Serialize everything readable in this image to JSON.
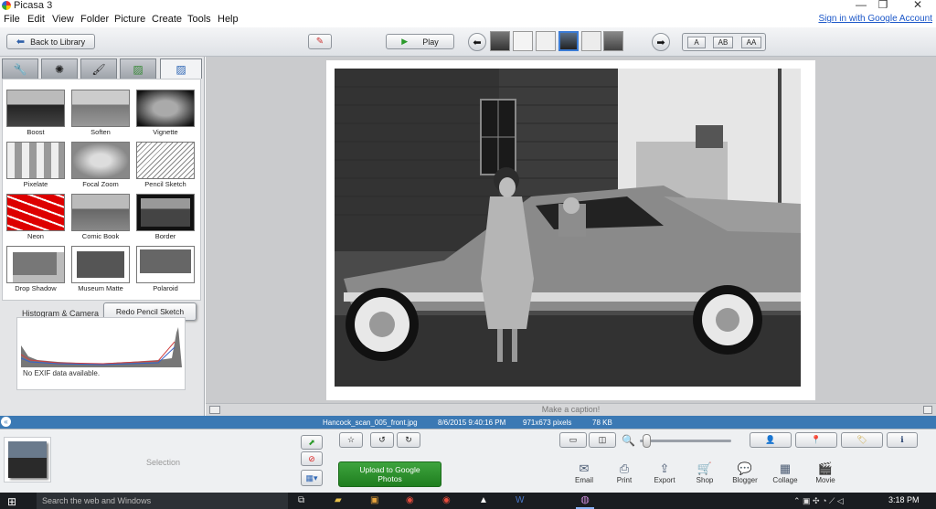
{
  "window": {
    "title": "Picasa 3"
  },
  "menu": {
    "file": "File",
    "edit": "Edit",
    "view": "View",
    "folder": "Folder",
    "picture": "Picture",
    "create": "Create",
    "tools": "Tools",
    "help": "Help",
    "signin": "Sign in with Google Account"
  },
  "toolbar": {
    "back_label": "Back to Library",
    "play_label": "Play",
    "caption_a": "A",
    "caption_ab": "AB",
    "caption_aa": "AA"
  },
  "effects": {
    "items": [
      {
        "label": "Boost"
      },
      {
        "label": "Soften"
      },
      {
        "label": "Vignette"
      },
      {
        "label": "Pixelate"
      },
      {
        "label": "Focal Zoom"
      },
      {
        "label": "Pencil Sketch"
      },
      {
        "label": "Neon"
      },
      {
        "label": "Comic Book"
      },
      {
        "label": "Border"
      },
      {
        "label": "Drop Shadow"
      },
      {
        "label": "Museum Matte"
      },
      {
        "label": "Polaroid"
      }
    ],
    "histogram_label": "Histogram & Camera",
    "redo_label": "Redo Pencil Sketch",
    "exif_text": "No EXIF data available."
  },
  "viewer": {
    "caption_placeholder": "Make a caption!"
  },
  "status": {
    "filename": "Hancock_scan_005_front.jpg",
    "datetime": "8/6/2015 9:40:16 PM",
    "dimensions": "971x673 pixels",
    "filesize": "78 KB"
  },
  "tray": {
    "selection_label": "Selection",
    "upload_label": "Upload to Google Photos"
  },
  "actions": [
    {
      "label": "Email",
      "icon": "email-icon"
    },
    {
      "label": "Print",
      "icon": "print-icon"
    },
    {
      "label": "Export",
      "icon": "export-icon"
    },
    {
      "label": "Shop",
      "icon": "shop-icon"
    },
    {
      "label": "Blogger",
      "icon": "blogger-icon"
    },
    {
      "label": "Collage",
      "icon": "collage-icon"
    },
    {
      "label": "Movie",
      "icon": "movie-icon"
    }
  ],
  "taskbar": {
    "search_placeholder": "Search the web and Windows",
    "clock": "3:18 PM"
  }
}
